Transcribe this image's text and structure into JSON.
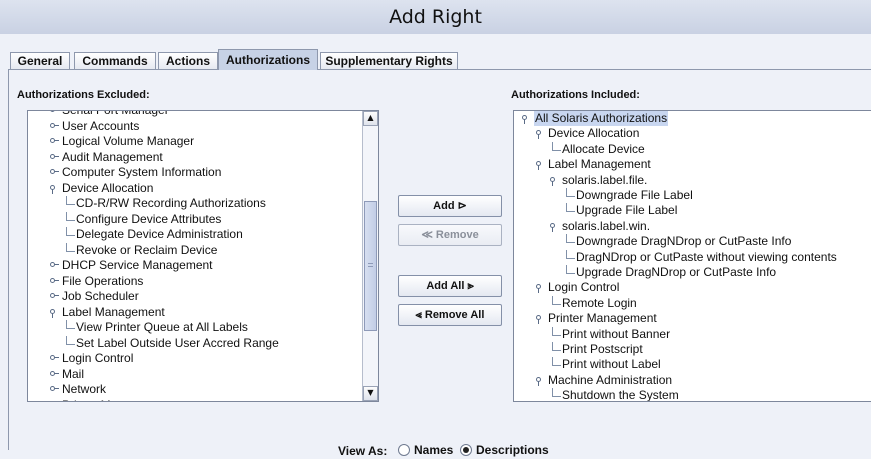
{
  "window": {
    "title": "Add Right"
  },
  "tabs": [
    "General",
    "Commands",
    "Actions",
    "Authorizations",
    "Supplementary Rights"
  ],
  "active_tab": "Authorizations",
  "excluded": {
    "label": "Authorizations Excluded:",
    "items": [
      "Serial Port Manager",
      "User Accounts",
      "Logical Volume Manager",
      "Audit Management",
      "Computer System Information",
      "Device Allocation",
      "CD-R/RW Recording Authorizations",
      "Configure Device Attributes",
      "Delegate Device Administration",
      "Revoke or Reclaim Device",
      "DHCP Service Management",
      "File Operations",
      "Job Scheduler",
      "Label Management",
      "View Printer Queue at All Labels",
      "Set Label Outside User Accred Range",
      "Login Control",
      "Mail",
      "Network",
      "Printer Management"
    ]
  },
  "included": {
    "label": "Authorizations Included:",
    "items": [
      "All Solaris Authorizations",
      "Device Allocation",
      "Allocate Device",
      "Label Management",
      "solaris.label.file.",
      "Downgrade File Label",
      "Upgrade File Label",
      "solaris.label.win.",
      "Downgrade DragNDrop or CutPaste Info",
      "DragNDrop or CutPaste without viewing contents",
      "Upgrade DragNDrop or CutPaste Info",
      "Login Control",
      "Remote Login",
      "Printer Management",
      "Print without Banner",
      "Print Postscript",
      "Print without Label",
      "Machine Administration",
      "Shutdown the System"
    ]
  },
  "buttons": {
    "add": "Add ⊳",
    "remove": "≪ Remove",
    "add_all": "Add All ⪢",
    "remove_all": "⪡ Remove All"
  },
  "view_as": {
    "label": "View As:",
    "options": [
      "Names",
      "Descriptions"
    ],
    "selected": "Descriptions"
  },
  "icons": {
    "scroll_up": "scroll-up-arrow-icon",
    "scroll_down": "scroll-down-arrow-icon"
  }
}
